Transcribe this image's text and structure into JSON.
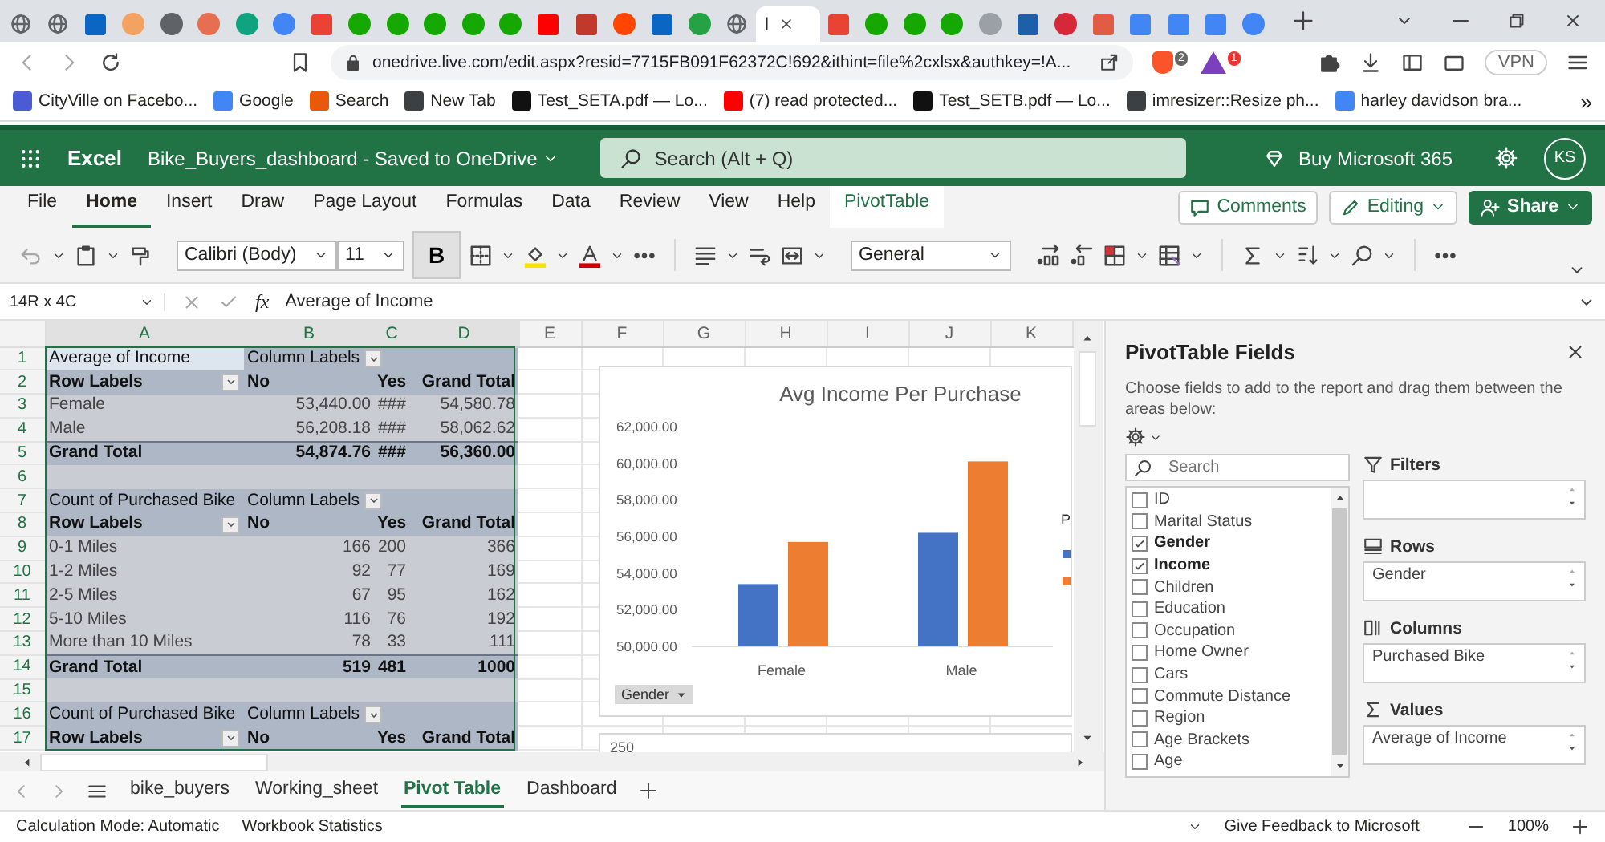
{
  "browser": {
    "tabs": [
      {
        "kind": "globe",
        "color": "#5f6368",
        "selected": false
      },
      {
        "kind": "globe",
        "color": "#5f6368",
        "selected": false
      },
      {
        "kind": "square",
        "color": "#0a66c2",
        "selected": false
      },
      {
        "kind": "circle",
        "color": "#f4a261",
        "selected": false
      },
      {
        "kind": "circle",
        "color": "#5f6368",
        "selected": false
      },
      {
        "kind": "circle",
        "color": "#e76f51",
        "selected": false
      },
      {
        "kind": "circle",
        "color": "#10a37f",
        "selected": false
      },
      {
        "kind": "circle",
        "color": "#4285f4",
        "selected": false
      },
      {
        "kind": "square",
        "color": "#ea4335",
        "selected": false
      },
      {
        "kind": "circle",
        "color": "#14a800",
        "selected": false
      },
      {
        "kind": "circle",
        "color": "#14a800",
        "selected": false
      },
      {
        "kind": "circle",
        "color": "#14a800",
        "selected": false
      },
      {
        "kind": "circle",
        "color": "#14a800",
        "selected": false
      },
      {
        "kind": "circle",
        "color": "#14a800",
        "selected": false
      },
      {
        "kind": "square",
        "color": "#ff0000",
        "selected": false
      },
      {
        "kind": "square",
        "color": "#c0392b",
        "selected": false
      },
      {
        "kind": "circle",
        "color": "#ff4500",
        "selected": false
      },
      {
        "kind": "square",
        "color": "#0a66c2",
        "selected": false
      },
      {
        "kind": "circle",
        "color": "#25a244",
        "selected": false
      },
      {
        "kind": "globe",
        "color": "#5f6368",
        "selected": false
      },
      {
        "kind": "page",
        "title": "I",
        "selected": true
      },
      {
        "kind": "square",
        "color": "#ea4335",
        "selected": false
      },
      {
        "kind": "circle",
        "color": "#14a800",
        "selected": false
      },
      {
        "kind": "circle",
        "color": "#14a800",
        "selected": false
      },
      {
        "kind": "circle",
        "color": "#14a800",
        "selected": false
      },
      {
        "kind": "circle",
        "color": "#9aa0a6",
        "selected": false
      },
      {
        "kind": "square",
        "color": "#1d5fa8",
        "selected": false
      },
      {
        "kind": "circle",
        "color": "#d62839",
        "selected": false
      },
      {
        "kind": "square",
        "color": "#e05d44",
        "selected": false
      },
      {
        "kind": "square",
        "color": "#4285f4",
        "selected": false
      },
      {
        "kind": "square",
        "color": "#4285f4",
        "selected": false
      },
      {
        "kind": "square",
        "color": "#4285f4",
        "selected": false
      },
      {
        "kind": "circle",
        "color": "#4285f4",
        "selected": false
      }
    ],
    "url": "onedrive.live.com/edit.aspx?resid=7715FB091F62372C!692&ithint=file%2cxlsx&authkey=!A...",
    "shield_badge": "2",
    "alert_badge": "1",
    "vpn": "VPN",
    "bookmarks": [
      {
        "label": "CityVille on Facebo...",
        "color": "#4a5bd4"
      },
      {
        "label": "Google",
        "color": "#4285f4"
      },
      {
        "label": "Search",
        "color": "#e8590c"
      },
      {
        "label": "New Tab",
        "color": "#3c4043"
      },
      {
        "label": "Test_SETA.pdf — Lo...",
        "color": "#111111"
      },
      {
        "label": "(7) read protected...",
        "color": "#ff0000"
      },
      {
        "label": "Test_SETB.pdf — Lo...",
        "color": "#111111"
      },
      {
        "label": "imresizer::Resize ph...",
        "color": "#3c4043"
      },
      {
        "label": "harley davidson bra...",
        "color": "#4285f4"
      }
    ],
    "more": "»"
  },
  "app": {
    "name": "Excel",
    "file": "Bike_Buyers_dashboard",
    "separator": "-",
    "status": "Saved to OneDrive",
    "search_placeholder": "Search (Alt + Q)",
    "buy": "Buy Microsoft 365",
    "user": "KS"
  },
  "ribbon": {
    "tabs": [
      {
        "label": "File",
        "kind": "normal",
        "selected": false
      },
      {
        "label": "Home",
        "kind": "normal",
        "selected": true
      },
      {
        "label": "Insert",
        "kind": "normal",
        "selected": false
      },
      {
        "label": "Draw",
        "kind": "normal",
        "selected": false
      },
      {
        "label": "Page Layout",
        "kind": "normal",
        "selected": false
      },
      {
        "label": "Formulas",
        "kind": "normal",
        "selected": false
      },
      {
        "label": "Data",
        "kind": "normal",
        "selected": false
      },
      {
        "label": "Review",
        "kind": "normal",
        "selected": false
      },
      {
        "label": "View",
        "kind": "normal",
        "selected": false
      },
      {
        "label": "Help",
        "kind": "normal",
        "selected": false
      },
      {
        "label": "PivotTable",
        "kind": "contextual",
        "selected": false
      }
    ],
    "comments": "Comments",
    "editing": "Editing",
    "share": "Share",
    "font": "Calibri (Body)",
    "size": "11",
    "bold": {
      "label": "B",
      "selected": true
    },
    "number_format": "General"
  },
  "formula_bar": {
    "name_box": "14R x 4C",
    "fx": "fx",
    "value": "Average of Income"
  },
  "sheet": {
    "columns": [
      "A",
      "B",
      "C",
      "D",
      "E",
      "F",
      "G",
      "H",
      "I",
      "J",
      "K"
    ],
    "rows": [
      {
        "n": "1",
        "kind": "title",
        "active": true,
        "cells": [
          "Average of Income",
          "Column Labels",
          null,
          null
        ]
      },
      {
        "n": "2",
        "kind": "labels",
        "cells": [
          "Row Labels",
          "No",
          "Yes",
          "Grand Total"
        ]
      },
      {
        "n": "3",
        "kind": "data",
        "cells": [
          "Female",
          "53,440.00",
          "###",
          "54,580.78"
        ]
      },
      {
        "n": "4",
        "kind": "data",
        "cells": [
          "Male",
          "56,208.18",
          "###",
          "58,062.62"
        ]
      },
      {
        "n": "5",
        "kind": "total",
        "cells": [
          "Grand Total",
          "54,874.76",
          "###",
          "56,360.00"
        ]
      },
      {
        "n": "6",
        "kind": "blank"
      },
      {
        "n": "7",
        "kind": "title",
        "cells": [
          "Count of Purchased Bike",
          "Column Labels",
          null,
          null
        ]
      },
      {
        "n": "8",
        "kind": "labels",
        "cells": [
          "Row Labels",
          "No",
          "Yes",
          "Grand Total"
        ]
      },
      {
        "n": "9",
        "kind": "data",
        "cells": [
          "0-1 Miles",
          "166",
          "200",
          "366"
        ]
      },
      {
        "n": "10",
        "kind": "data",
        "cells": [
          "1-2 Miles",
          "92",
          "77",
          "169"
        ]
      },
      {
        "n": "11",
        "kind": "data",
        "cells": [
          "2-5 Miles",
          "67",
          "95",
          "162"
        ]
      },
      {
        "n": "12",
        "kind": "data",
        "cells": [
          "5-10 Miles",
          "116",
          "76",
          "192"
        ]
      },
      {
        "n": "13",
        "kind": "data",
        "cells": [
          "More than 10 Miles",
          "78",
          "33",
          "111"
        ]
      },
      {
        "n": "14",
        "kind": "total",
        "cells": [
          "Grand Total",
          "519",
          "481",
          "1000"
        ]
      },
      {
        "n": "15",
        "kind": "blank"
      },
      {
        "n": "16",
        "kind": "title",
        "cells": [
          "Count of Purchased Bike",
          "Column Labels",
          null,
          null
        ]
      },
      {
        "n": "17",
        "kind": "labels",
        "cells": [
          "Row Labels",
          "No",
          "Yes",
          "Grand Total"
        ]
      }
    ],
    "chart": {
      "legend_title": "P",
      "field_button": "Gender",
      "chart_data": {
        "type": "bar",
        "title": "Avg Income Per Purchase",
        "categories": [
          "Female",
          "Male"
        ],
        "series": [
          {
            "color": "#4472c4",
            "values": [
              53400,
              56200
            ]
          },
          {
            "color": "#ed7d31",
            "values": [
              55700,
              60100
            ]
          }
        ],
        "ylim": [
          50000,
          62000
        ],
        "yticks": [
          {
            "value": 50000,
            "label": "50,000.00"
          },
          {
            "value": 52000,
            "label": "52,000.00"
          },
          {
            "value": 54000,
            "label": "54,000.00"
          },
          {
            "value": 56000,
            "label": "56,000.00"
          },
          {
            "value": 58000,
            "label": "58,000.00"
          },
          {
            "value": 60000,
            "label": "60,000.00"
          },
          {
            "value": 62000,
            "label": "62,000.00"
          }
        ]
      }
    },
    "next_chart_label": "250"
  },
  "sheet_tabs": [
    {
      "label": "bike_buyers",
      "selected": false
    },
    {
      "label": "Working_sheet",
      "selected": false
    },
    {
      "label": "Pivot Table",
      "selected": true
    },
    {
      "label": "Dashboard",
      "selected": false
    }
  ],
  "pivot_panel": {
    "title": "PivotTable Fields",
    "description": "Choose fields to add to the report and drag them between the areas below:",
    "search_placeholder": "Search",
    "fields": [
      {
        "label": "ID",
        "checked": false
      },
      {
        "label": "Marital Status",
        "checked": false
      },
      {
        "label": "Gender",
        "checked": true
      },
      {
        "label": "Income",
        "checked": true
      },
      {
        "label": "Children",
        "checked": false
      },
      {
        "label": "Education",
        "checked": false
      },
      {
        "label": "Occupation",
        "checked": false
      },
      {
        "label": "Home Owner",
        "checked": false
      },
      {
        "label": "Cars",
        "checked": false
      },
      {
        "label": "Commute Distance",
        "checked": false
      },
      {
        "label": "Region",
        "checked": false
      },
      {
        "label": "Age Brackets",
        "checked": false
      },
      {
        "label": "Age",
        "checked": false
      }
    ],
    "areas": [
      {
        "kind": "filters",
        "label": "Filters"
      },
      {
        "kind": "rows",
        "label": "Rows",
        "value": "Gender"
      },
      {
        "kind": "columns",
        "label": "Columns",
        "value": "Purchased Bike"
      },
      {
        "kind": "values",
        "label": "Values",
        "value": "Average of Income"
      }
    ]
  },
  "status_bar": {
    "calc_mode": "Calculation Mode: Automatic",
    "stats": "Workbook Statistics",
    "feedback": "Give Feedback to Microsoft",
    "zoom": "100%"
  }
}
